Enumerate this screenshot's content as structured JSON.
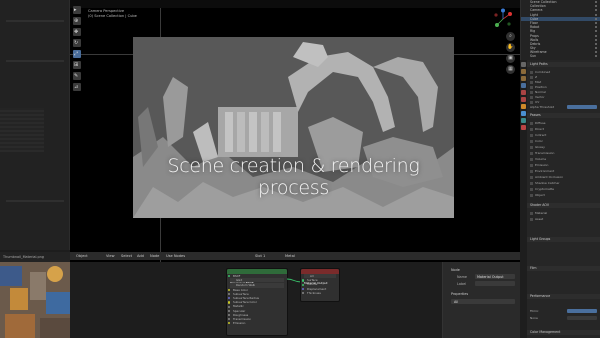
{
  "viewport": {
    "title_line1": "Camera Perspective",
    "title_line2": "(0) Scene Collection | Cube",
    "caption": "Scene creation & rendering process",
    "tools": [
      "select-icon",
      "cursor-icon",
      "move-icon",
      "rotate-icon",
      "scale-icon",
      "transform-icon",
      "annotate-icon",
      "measure-icon",
      "add-cube-icon"
    ],
    "nav_buttons": [
      "zoom-icon",
      "hand-icon",
      "camera-icon",
      "grid-icon"
    ]
  },
  "outliner": {
    "items": [
      "Scene Collection",
      "Collection",
      "Camera",
      "Light",
      "Cube",
      "Floor",
      "Robot",
      "Rig",
      "Props",
      "Walls",
      "Debris",
      "Sky",
      "Wireframe",
      "Sun",
      "Plane"
    ]
  },
  "properties": {
    "sections": [
      "Light Paths",
      "Passes",
      "Denoising Data",
      "Indirect Light",
      "Shader AOV",
      "Light Groups",
      "Film",
      "Performance",
      "Bake",
      "Grease Pencil",
      "Freestyle",
      "Color Management"
    ],
    "field_labels": [
      "Combined",
      "Z",
      "Mist",
      "Position",
      "Normal",
      "Vector",
      "UV",
      "Denoising Data",
      "Alpha Threshold",
      "Diffuse",
      "Direct",
      "Indirect",
      "Color",
      "Glossy",
      "Transmission",
      "Volume",
      "Emission",
      "Environment",
      "Ambient Occlusion",
      "Shadow Catcher",
      "Cryptomatte",
      "Object",
      "Material",
      "Asset"
    ],
    "accent": "#4a6f9d",
    "bottom_labels": {
      "view_transform": "Filmic",
      "look": "None",
      "exposure": "0",
      "gamma": "1.000"
    }
  },
  "node_editor": {
    "menus": [
      "Object",
      "View",
      "Select",
      "Add",
      "Node",
      "Use Nodes"
    ],
    "slot": "Slot 1",
    "material": "Metal",
    "bsdf_title": "Principled BSDF",
    "bsdf_rows": [
      "BSDF",
      "GGX",
      "Random Walk",
      "Base Color",
      "Subsurface",
      "Subsurface Radius",
      "Subsurface Color",
      "Metallic",
      "Specular",
      "Roughness",
      "Transmission",
      "Emission",
      "Alpha",
      "Normal"
    ],
    "output_title": "Material Output",
    "output_rows": [
      "All",
      "Surface",
      "Volume",
      "Displacement",
      "Thickness"
    ],
    "header_colors": {
      "bsdf": "#2f6b3a",
      "output": "#7a2b2b"
    }
  },
  "side_panel": {
    "section": "Node",
    "name_label": "Name",
    "name_value": "Material Output",
    "label_label": "Label",
    "properties_label": "Properties",
    "target": "All"
  },
  "thumbnail": {
    "title": "Thumbnail_Material.png"
  }
}
